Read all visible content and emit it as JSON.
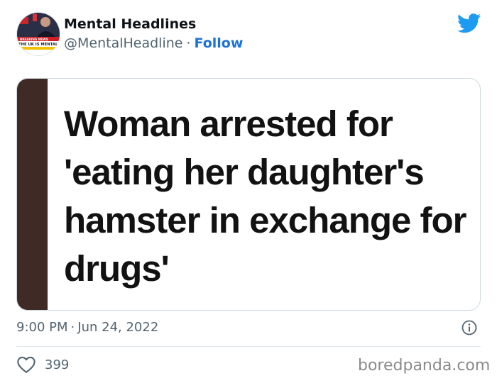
{
  "author": {
    "display_name": "Mental Headlines",
    "handle": "@MentalHeadline",
    "separator": "·",
    "follow_label": "Follow",
    "avatar": {
      "badge_top": "BREAKING NEWS",
      "badge_main": "THE UK IS MENTAL"
    }
  },
  "media": {
    "headline": "Woman arrested for 'eating her daughter's hamster in exchange for drugs'",
    "bar_color": "#3f2a25"
  },
  "meta": {
    "time": "9:00 PM",
    "separator": "·",
    "date": "Jun 24, 2022"
  },
  "actions": {
    "like_count": "399"
  },
  "watermark": "boredpanda.com",
  "icons": {
    "brand": "twitter-bird-icon",
    "info": "info-icon",
    "like": "heart-icon"
  },
  "colors": {
    "twitter_blue": "#1d9bf0",
    "link_blue": "#1d72d8",
    "secondary_text": "#536471"
  }
}
